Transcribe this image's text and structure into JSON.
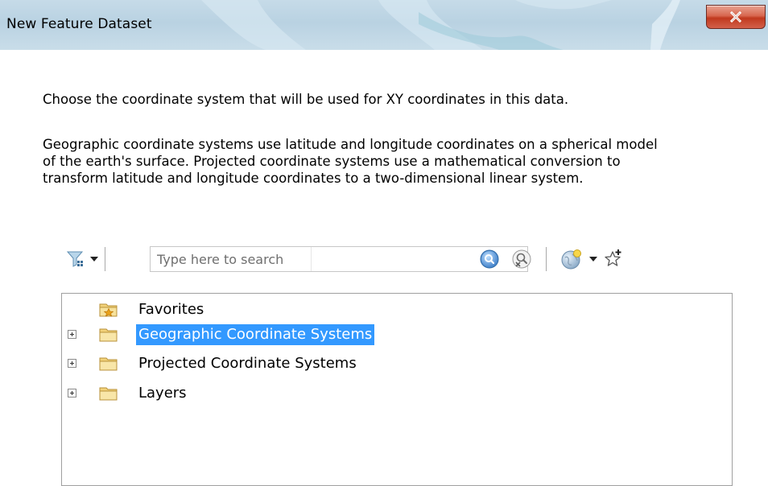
{
  "window": {
    "title": "New Feature Dataset",
    "close_glyph": "X"
  },
  "content": {
    "intro": "Choose the coordinate system that will be used for XY coordinates in this data.",
    "description_lines": [
      "Geographic coordinate systems use latitude and longitude coordinates on a spherical model",
      "of the earth's surface. Projected coordinate systems use a mathematical conversion to",
      "transform latitude and longitude coordinates to a two-dimensional linear system."
    ]
  },
  "toolbar": {
    "filter_icon": "filter-icon",
    "search": {
      "placeholder": "Type here to search",
      "value": ""
    },
    "search_button_icon": "magnifier-icon",
    "clear_search_icon": "clear-search-icon",
    "globe_icon": "globe-icon",
    "add_favorite_icon": "add-favorite-star-icon"
  },
  "tree": {
    "items": [
      {
        "label": "Favorites",
        "expandable": false,
        "selected": false,
        "icon": "favorites-folder-icon"
      },
      {
        "label": "Geographic Coordinate Systems",
        "expandable": true,
        "selected": true,
        "icon": "folder-icon"
      },
      {
        "label": "Projected Coordinate Systems",
        "expandable": true,
        "selected": false,
        "icon": "folder-icon"
      },
      {
        "label": "Layers",
        "expandable": true,
        "selected": false,
        "icon": "folder-icon"
      }
    ]
  },
  "colors": {
    "selection": "#3399ff",
    "close_button": "#c7402a",
    "titlebar": "#c0d6e4"
  }
}
